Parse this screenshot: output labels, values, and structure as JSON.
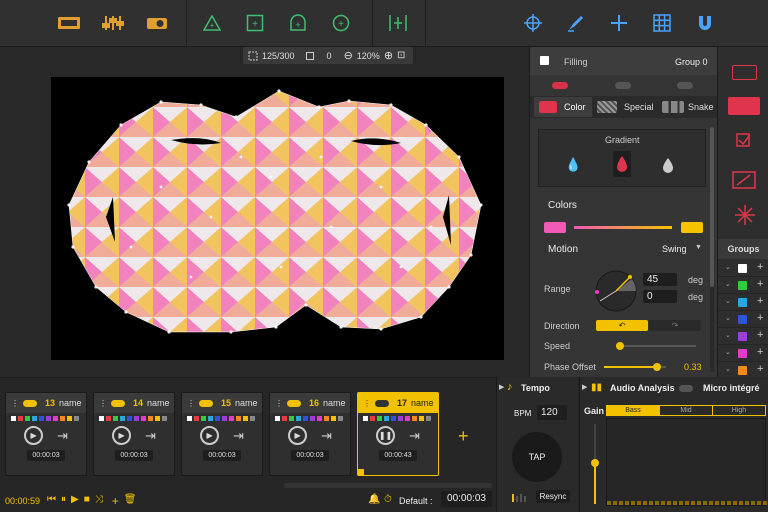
{
  "zoom": {
    "frame": "125/300",
    "offset": "0",
    "percent": "120%"
  },
  "panel": {
    "filling_label": "Filling",
    "group_label": "Group 0",
    "tabs": {
      "color": "Color",
      "special": "Special",
      "snake": "Snake"
    },
    "gradient_label": "Gradient",
    "colors_label": "Colors",
    "color_start": "#f05ab4",
    "color_end": "#f5c400",
    "motion_label": "Motion",
    "motion_mode": "Swing",
    "range_label": "Range",
    "range_a": "45",
    "range_b": "0",
    "deg": "deg",
    "direction_label": "Direction",
    "speed_label": "Speed",
    "phase_label": "Phase Offset",
    "phase_value": "0.33",
    "speed_fraction": 0.05,
    "phase_fraction": 0.85
  },
  "groups": {
    "label": "Groups",
    "swatches": [
      "#ffffff",
      "#2ecc40",
      "#28a8e0",
      "#2c56d8",
      "#9b3fd8",
      "#e83acb",
      "#f08a1c"
    ]
  },
  "cards": [
    {
      "num": "13",
      "name": "name",
      "time": "00:00:03"
    },
    {
      "num": "14",
      "name": "name",
      "time": "00:00:03"
    },
    {
      "num": "15",
      "name": "name",
      "time": "00:00:03"
    },
    {
      "num": "16",
      "name": "name",
      "time": "00:00:03"
    },
    {
      "num": "17",
      "name": "name",
      "time": "00:00:43"
    }
  ],
  "transport": {
    "time": "00:00:59",
    "default_label": "Default :",
    "default_time": "00:00:03"
  },
  "tempo": {
    "label": "Tempo",
    "bpm_label": "BPM",
    "bpm": "120",
    "tap": "TAP",
    "resync": "Resync"
  },
  "audio": {
    "label": "Audio Analysis",
    "device": "Micro intégré",
    "gain": "Gain",
    "bands": [
      "Bass",
      "Mid",
      "High"
    ]
  }
}
